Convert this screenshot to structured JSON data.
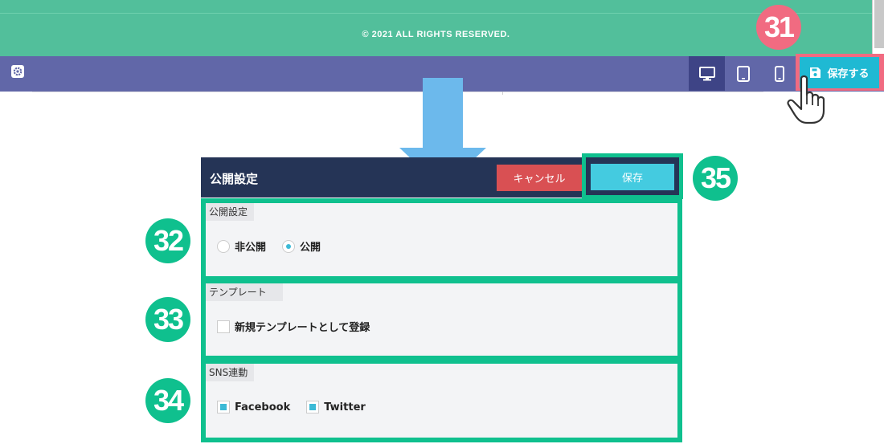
{
  "footer": {
    "copyright": "© 2021 ALL RIGHTS RESERVED."
  },
  "toolbar": {
    "settings_icon": "gear-icon",
    "devices": [
      {
        "icon": "desktop-icon",
        "active": true
      },
      {
        "icon": "tablet-icon",
        "active": false
      },
      {
        "icon": "mobile-icon",
        "active": false
      }
    ],
    "save_label": "保存する",
    "save_icon": "floppy-disk-icon"
  },
  "badges": {
    "b31": "31",
    "b32": "32",
    "b33": "33",
    "b34": "34",
    "b35": "35"
  },
  "dialog": {
    "title": "公開設定",
    "cancel_label": "キャンセル",
    "save_label": "保存",
    "sections": {
      "publish": {
        "legend": "公開設定",
        "options": [
          {
            "label": "非公開",
            "checked": false
          },
          {
            "label": "公開",
            "checked": true
          }
        ]
      },
      "template": {
        "legend": "テンプレート",
        "checkbox_label": "新規テンプレートとして登録",
        "checked": false
      },
      "sns": {
        "legend": "SNS連動",
        "options": [
          {
            "label": "Facebook",
            "checked": true
          },
          {
            "label": "Twitter",
            "checked": true
          }
        ]
      }
    }
  },
  "colors": {
    "accent_green": "#0fc08e",
    "highlight_pink": "#f16b81",
    "toolbar_purple": "#6167a8",
    "dialog_navy": "#253456",
    "save_cyan": "#1fb9d3"
  }
}
